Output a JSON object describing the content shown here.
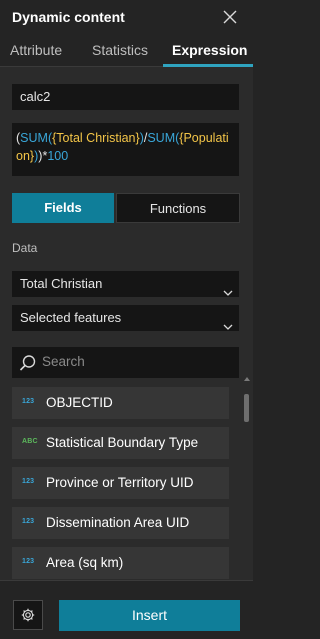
{
  "panel": {
    "title": "Dynamic content"
  },
  "tabs": [
    {
      "label": "Attribute"
    },
    {
      "label": "Statistics"
    },
    {
      "label": "Expression"
    }
  ],
  "expression_name": {
    "value": "calc2"
  },
  "expression_tokens": [
    {
      "text": "(",
      "kind": "op"
    },
    {
      "text": "SUM",
      "kind": "fn"
    },
    {
      "text": "(",
      "kind": "fn"
    },
    {
      "text": "{Total Christian}",
      "kind": "fld"
    },
    {
      "text": ")",
      "kind": "fn"
    },
    {
      "text": "/",
      "kind": "op"
    },
    {
      "text": "SUM",
      "kind": "fn"
    },
    {
      "text": "(",
      "kind": "fn"
    },
    {
      "text": "{Population}",
      "kind": "fld"
    },
    {
      "text": ")",
      "kind": "fn"
    },
    {
      "text": ")",
      "kind": "op"
    },
    {
      "text": "*",
      "kind": "op"
    },
    {
      "text": "100",
      "kind": "num"
    }
  ],
  "mode_toggle": {
    "fields_label": "Fields",
    "functions_label": "Functions",
    "selected": "Fields"
  },
  "data_section": {
    "label": "Data",
    "field_select": "Total Christian",
    "scope_select": "Selected features"
  },
  "search": {
    "placeholder": "Search"
  },
  "field_list": [
    {
      "type_icon": "123",
      "name": "OBJECTID",
      "kind": "num"
    },
    {
      "type_icon": "ABC",
      "name": "Statistical Boundary Type",
      "kind": "str"
    },
    {
      "type_icon": "123",
      "name": "Province or Territory UID",
      "kind": "num"
    },
    {
      "type_icon": "123",
      "name": "Dissemination Area UID",
      "kind": "num"
    },
    {
      "type_icon": "123",
      "name": "Area (sq km)",
      "kind": "num"
    }
  ],
  "footer": {
    "insert_label": "Insert"
  },
  "colors": {
    "accent": "#0f7e99",
    "function": "#39a6d8",
    "field": "#f3c548",
    "string_type": "#5cb85c"
  }
}
